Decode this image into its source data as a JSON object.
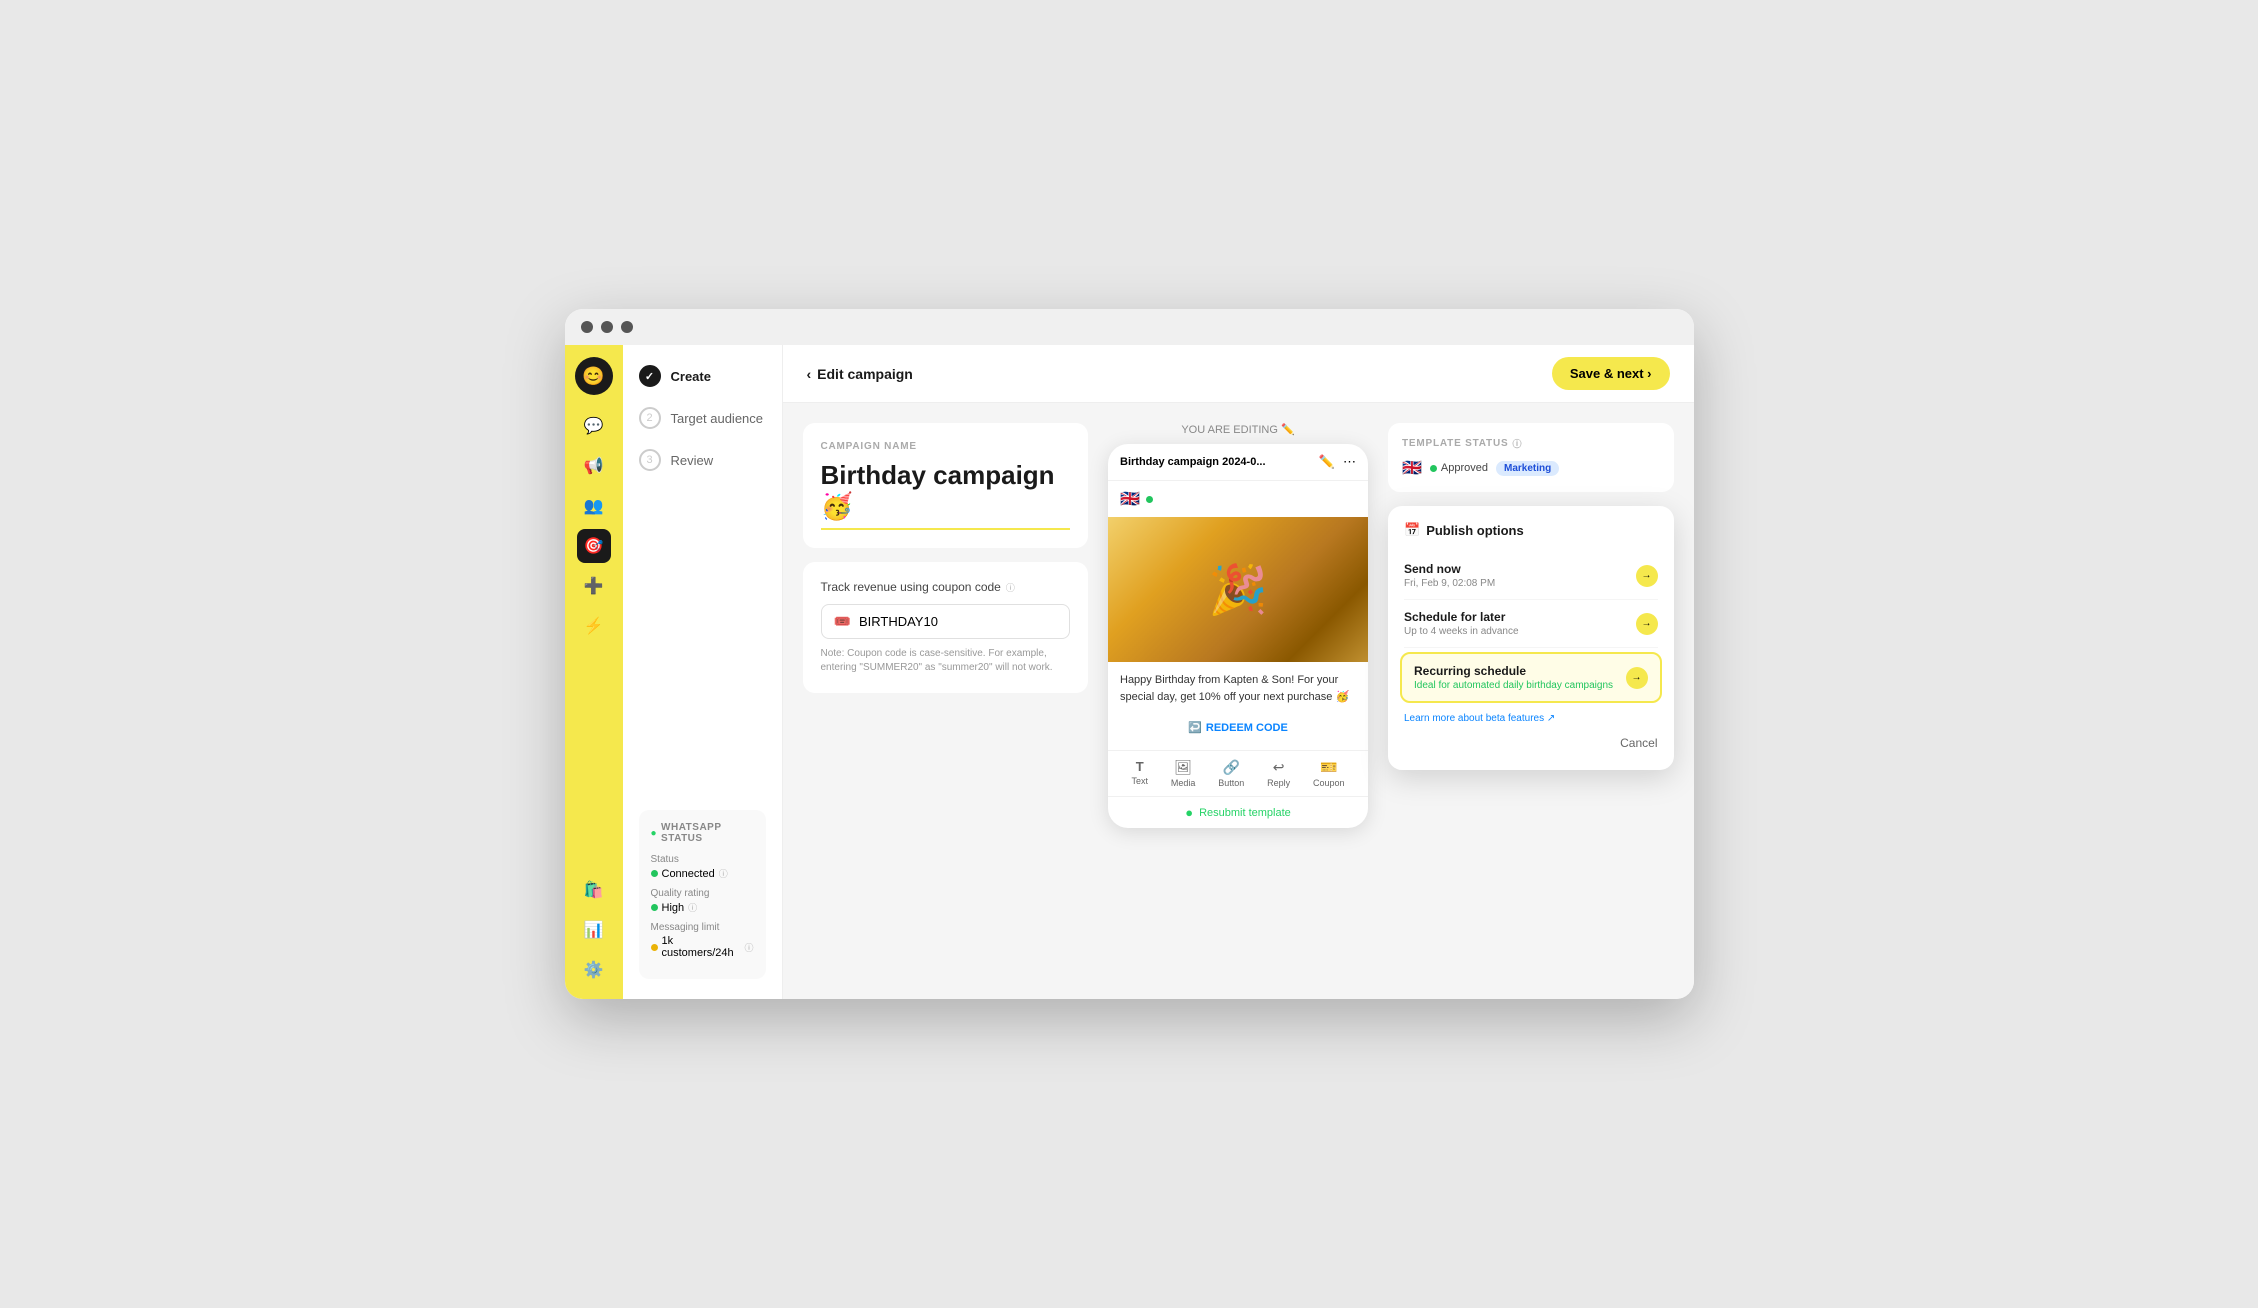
{
  "browser": {
    "dots": [
      "dot1",
      "dot2",
      "dot3"
    ]
  },
  "topbar": {
    "back_label": "Edit campaign",
    "save_label": "Save & next ›"
  },
  "sidebar": {
    "logo_icon": "😊",
    "items": [
      {
        "id": "chat",
        "icon": "💬"
      },
      {
        "id": "megaphone",
        "icon": "📢"
      },
      {
        "id": "audience",
        "icon": "👥"
      },
      {
        "id": "campaigns",
        "icon": "🎯"
      },
      {
        "id": "add",
        "icon": "➕"
      },
      {
        "id": "lightning",
        "icon": "⚡"
      },
      {
        "id": "bag",
        "icon": "🛍️"
      },
      {
        "id": "chart",
        "icon": "📊"
      },
      {
        "id": "settings",
        "icon": "⚙️"
      }
    ]
  },
  "nav": {
    "steps": [
      {
        "number": "✓",
        "label": "Create",
        "status": "done"
      },
      {
        "number": "2",
        "label": "Target audience",
        "status": "inactive"
      },
      {
        "number": "3",
        "label": "Review",
        "status": "inactive"
      }
    ]
  },
  "whatsapp_status": {
    "title": "WHATSAPP STATUS",
    "status_label": "Status",
    "status_value": "Connected",
    "quality_label": "Quality rating",
    "quality_value": "High",
    "messaging_label": "Messaging limit",
    "messaging_value": "1k customers/24h"
  },
  "editing_label": "YOU ARE EDITING ✏️",
  "campaign": {
    "name_label": "CAMPAIGN NAME",
    "name_value": "Birthday campaign 🥳",
    "coupon_section_label": "Track revenue using coupon code",
    "coupon_value": "BIRTHDAY10",
    "coupon_note": "Note: Coupon code is case-sensitive. For example, entering \"SUMMER20\" as \"summer20\" will not work."
  },
  "phone_preview": {
    "header_title": "Birthday campaign 2024-0...",
    "message": "Happy Birthday from Kapten & Son! For your special day, get 10% off your next purchase 🥳",
    "redeem_label": "REDEEM CODE",
    "toolbar_items": [
      {
        "icon": "T",
        "label": "Text"
      },
      {
        "icon": "🖼",
        "label": "Media"
      },
      {
        "icon": "🔗",
        "label": "Button"
      },
      {
        "icon": "↩",
        "label": "Reply"
      },
      {
        "icon": "🎫",
        "label": "Coupon"
      }
    ],
    "resubmit_label": "Resubmit template"
  },
  "template_status": {
    "label": "TEMPLATE STATUS",
    "flag": "🇬🇧",
    "approved_label": "Approved",
    "badge_label": "Marketing"
  },
  "publish_options": {
    "title": "Publish options",
    "options": [
      {
        "id": "send-now",
        "title": "Send now",
        "subtitle": "Fri, Feb 9, 02:08 PM",
        "selected": false
      },
      {
        "id": "schedule-later",
        "title": "Schedule for later",
        "subtitle": "Up to 4 weeks in advance",
        "selected": false
      },
      {
        "id": "recurring",
        "title": "Recurring schedule",
        "subtitle": "Ideal for automated daily birthday campaigns",
        "selected": true
      }
    ],
    "learn_more": "Learn more about beta features ↗",
    "cancel_label": "Cancel"
  }
}
